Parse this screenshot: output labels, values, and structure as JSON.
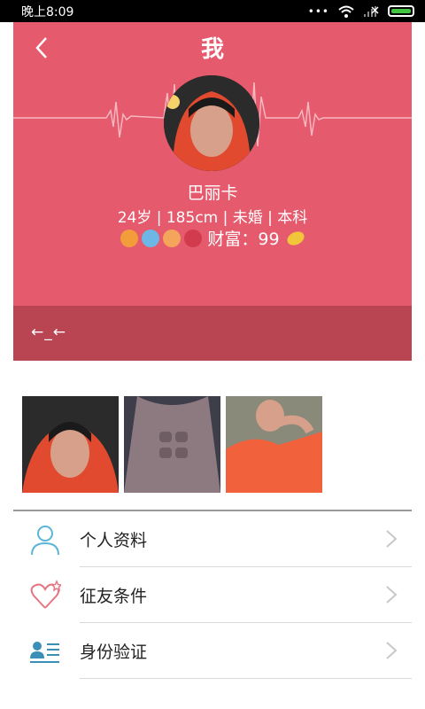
{
  "status": {
    "time": "晚上8:09",
    "dots": "•••"
  },
  "header": {
    "title": "我"
  },
  "profile": {
    "name": "巴丽卡",
    "info": "24岁 | 185cm | 未婚 | 本科",
    "wealth_label": "财富：99",
    "badges": [
      "crown-badge",
      "chat-badge",
      "coin-stack-badge",
      "heart-vip-badge"
    ]
  },
  "band": {
    "text": "←_←"
  },
  "photos": [
    "photo-1",
    "photo-2",
    "photo-3"
  ],
  "menu": {
    "items": [
      {
        "label": "个人资料",
        "icon": "person-icon"
      },
      {
        "label": "征友条件",
        "icon": "heart-star-icon"
      },
      {
        "label": "身份验证",
        "icon": "id-card-icon"
      }
    ]
  },
  "colors": {
    "accent": "#e55a6d",
    "band": "#b94553",
    "icon_blue": "#5ab6d6",
    "icon_red": "#e57583"
  }
}
